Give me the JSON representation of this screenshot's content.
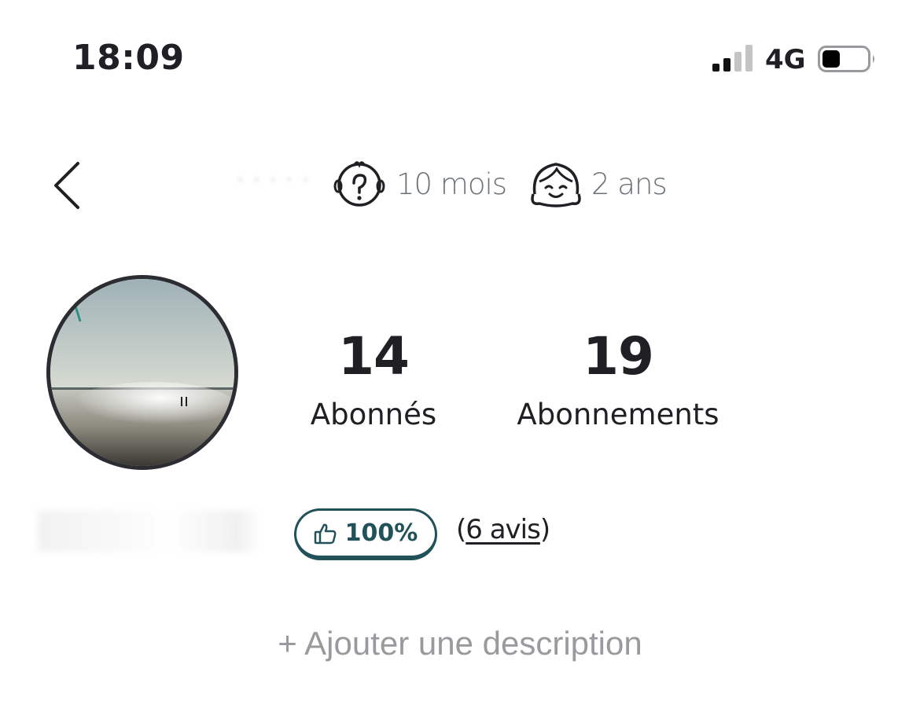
{
  "status_bar": {
    "time": "18:09",
    "network": "4G",
    "signal_icon": "cellular-signal-icon",
    "battery_icon": "battery-icon"
  },
  "header": {
    "back_icon": "chevron-left-icon",
    "children": [
      {
        "icon": "baby-question-icon",
        "label": "10 mois"
      },
      {
        "icon": "smiling-child-icon",
        "label": "2 ans"
      }
    ]
  },
  "profile": {
    "stats": {
      "followers_value": "14",
      "followers_label": "Abonnés",
      "following_value": "19",
      "following_label": "Abonnements"
    },
    "rating": {
      "icon": "thumbs-up-icon",
      "value": "100%",
      "reviews_open": "(",
      "reviews_text": "6 avis",
      "reviews_close": ")"
    },
    "add_description": "+ Ajouter une description"
  },
  "colors": {
    "accent": "#215159",
    "text": "#1f1f24",
    "muted": "#9a9a9e",
    "secondary": "#6c7378"
  }
}
